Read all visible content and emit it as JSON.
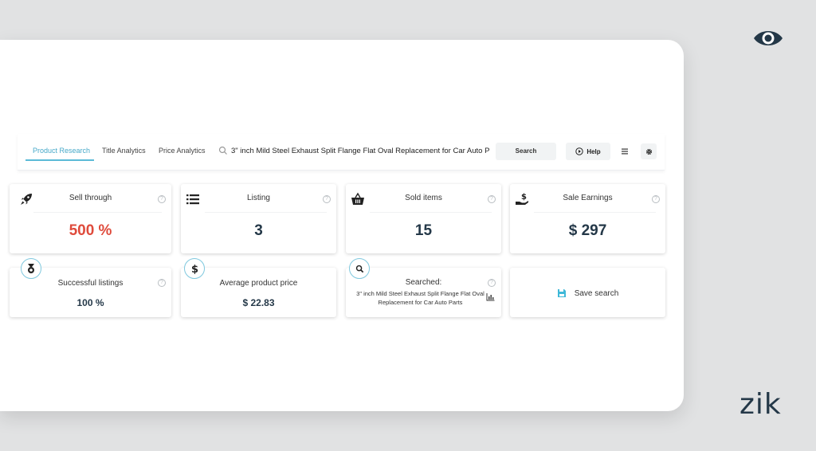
{
  "toolbar": {
    "tabs": [
      "Product Research",
      "Title Analytics",
      "Price Analytics"
    ],
    "search_value": "3\" inch Mild Steel Exhaust Split Flange Flat Oval Replacement for Car Auto P",
    "search_button": "Search",
    "help_button": "Help"
  },
  "cards": {
    "sell_through": {
      "title": "Sell through",
      "value": "500 %"
    },
    "listing": {
      "title": "Listing",
      "value": "3"
    },
    "sold_items": {
      "title": "Sold items",
      "value": "15"
    },
    "sale_earnings": {
      "title": "Sale Earnings",
      "value": "$ 297"
    },
    "successful_listings": {
      "title": "Successful listings",
      "value": "100 %"
    },
    "average_price": {
      "title": "Average product price",
      "value": "$ 22.83"
    },
    "searched": {
      "title": "Searched:",
      "query": "3\" inch Mild Steel Exhaust Split Flange Flat Oval Replacement for Car Auto Parts"
    },
    "save_search": {
      "label": "Save search"
    }
  },
  "qmark": "?",
  "brand": {
    "wordmark": "zik"
  },
  "colors": {
    "accent": "#47a9c9",
    "value_dark": "#243848",
    "value_red": "#df4b3c",
    "save_icon": "#3fb8d8"
  },
  "icons": [
    "rocket-icon",
    "list-icon",
    "basket-icon",
    "money-hand-icon",
    "medal-icon",
    "dollar-icon",
    "search-icon",
    "save-icon",
    "bar-chart-icon",
    "play-circle-icon",
    "menu-icon",
    "gear-icon",
    "eye-logo-icon"
  ]
}
